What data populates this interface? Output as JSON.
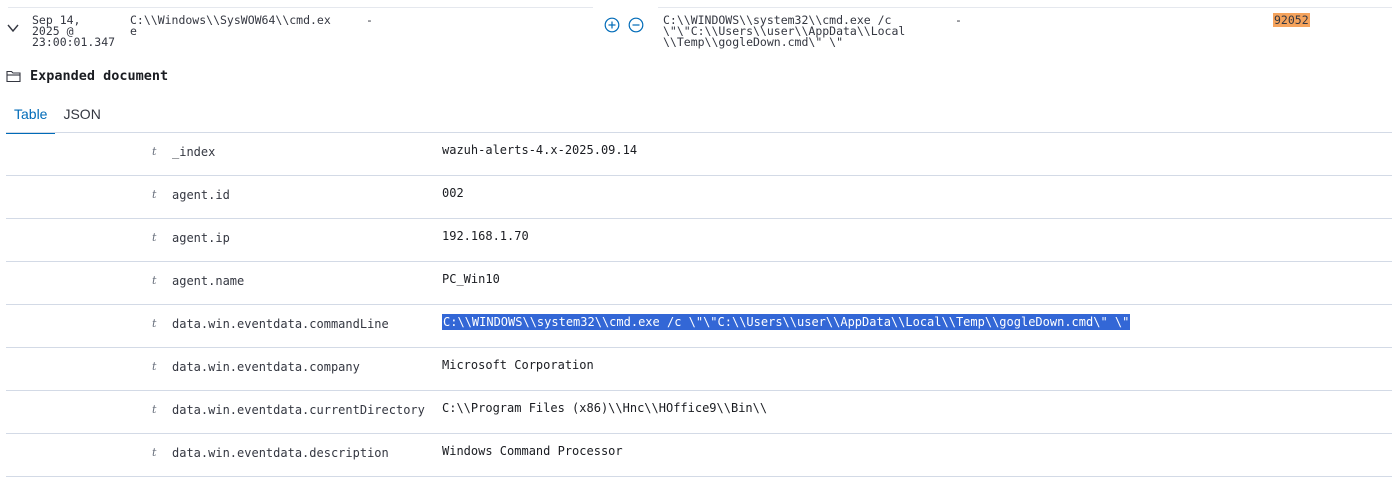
{
  "summary": {
    "timestamp": "Sep 14,\n2025 @\n23:00:01.347",
    "image": "C:\\\\Windows\\\\SysWOW64\\\\cmd.ex\ne",
    "dash1": "-",
    "command_line": "C:\\\\WINDOWS\\\\system32\\\\cmd.exe /c\n\\\"\\\"C:\\\\Users\\\\user\\\\AppData\\\\Local\n\\\\Temp\\\\gogleDown.cmd\\\" \\\"",
    "dash2": "-",
    "rule_id": "92052"
  },
  "expanded": {
    "title": "Expanded document"
  },
  "tabs": [
    {
      "label": "Table",
      "active": true
    },
    {
      "label": "JSON",
      "active": false
    }
  ],
  "fields": [
    {
      "type": "t",
      "name": "_index",
      "value": "wazuh-alerts-4.x-2025.09.14"
    },
    {
      "type": "t",
      "name": "agent.id",
      "value": "002"
    },
    {
      "type": "t",
      "name": "agent.ip",
      "value": "192.168.1.70"
    },
    {
      "type": "t",
      "name": "agent.name",
      "value": "PC_Win10"
    },
    {
      "type": "t",
      "name": "data.win.eventdata.commandLine",
      "value": "C:\\\\WINDOWS\\\\system32\\\\cmd.exe /c \\\"\\\"C:\\\\Users\\\\user\\\\AppData\\\\Local\\\\Temp\\\\gogleDown.cmd\\\" \\\""
    },
    {
      "type": "t",
      "name": "data.win.eventdata.company",
      "value": "Microsoft Corporation"
    },
    {
      "type": "t",
      "name": "data.win.eventdata.currentDirectory",
      "value": "C:\\\\Program Files (x86)\\\\Hnc\\\\HOffice9\\\\Bin\\\\"
    },
    {
      "type": "t",
      "name": "data.win.eventdata.description",
      "value": "Windows Command Processor"
    }
  ],
  "colors": {
    "accent": "#006bb8",
    "highlight_orange": "#f5a35c",
    "selection": "#3367d6"
  },
  "icons": {
    "chevron": "chevron-down-icon",
    "filter_in": "plus-circle-icon",
    "filter_out": "minus-circle-icon",
    "folder": "folder-open-icon"
  }
}
